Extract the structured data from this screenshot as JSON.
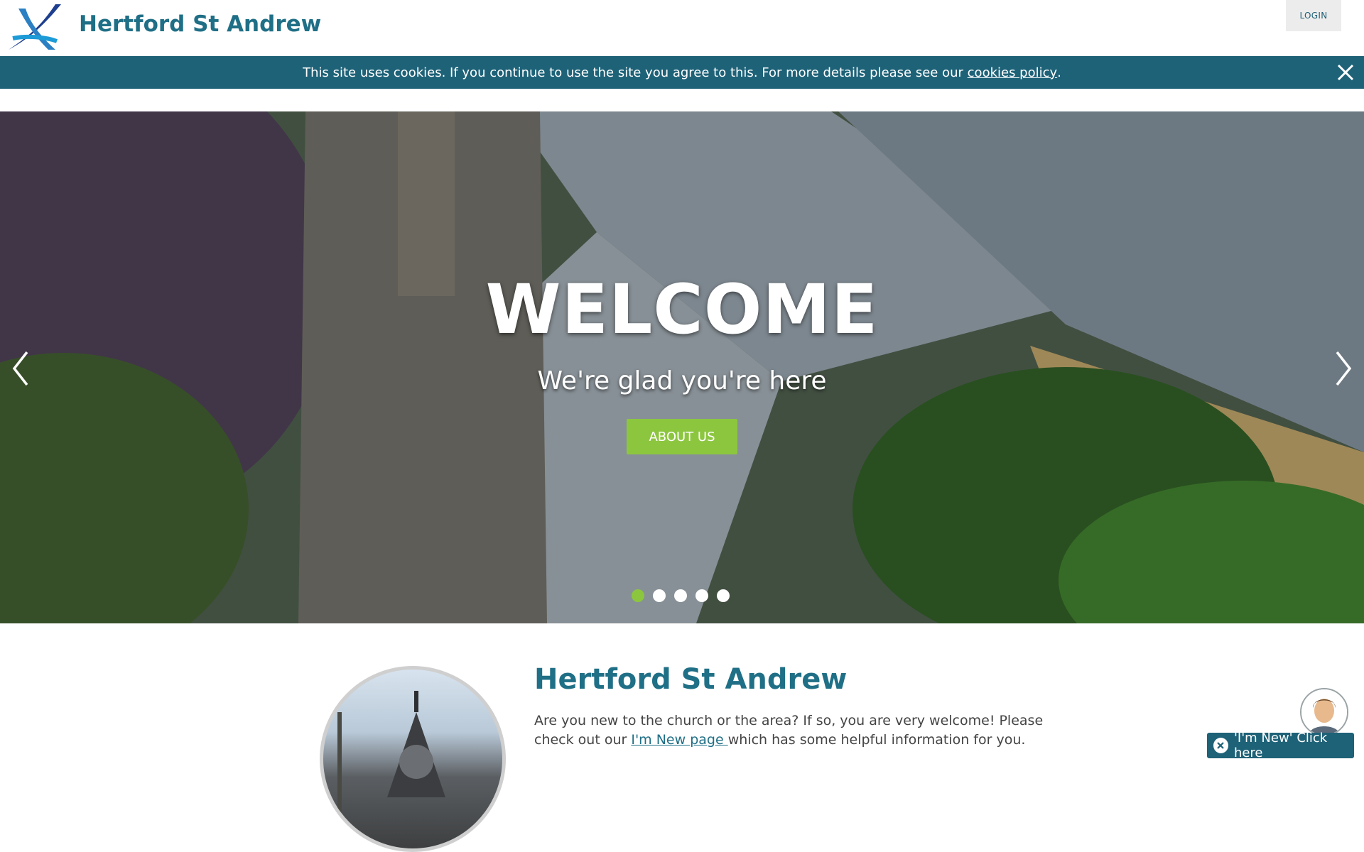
{
  "header": {
    "site_title": "Hertford St Andrew",
    "login_label": "LOGIN"
  },
  "cookie_bar": {
    "text": "This site uses cookies. If you continue to use the site you agree to this. For more details please see our ",
    "link_label": "cookies policy",
    "suffix": "."
  },
  "hero": {
    "title": "WELCOME",
    "subtitle": "We're glad you're here",
    "button_label": "ABOUT US",
    "slides": [
      {
        "active": true
      },
      {
        "active": false
      },
      {
        "active": false
      },
      {
        "active": false
      },
      {
        "active": false
      }
    ]
  },
  "content": {
    "title": "Hertford St Andrew",
    "text_before": "Are you new to the church or the area? If so, you are very welcome! Please check out our ",
    "link_label": "I'm New page ",
    "text_after": "which has some helpful information for you."
  },
  "helper": {
    "button_label": "'I'm New' Click here"
  },
  "colors": {
    "brand_teal": "#1f6f86",
    "cookie_bar": "#1e6278",
    "accent_green": "#8cc63f"
  },
  "icons": {
    "logo": "stylized-x-logo-icon",
    "close": "close-icon",
    "prev": "chevron-left-icon",
    "next": "chevron-right-icon"
  }
}
